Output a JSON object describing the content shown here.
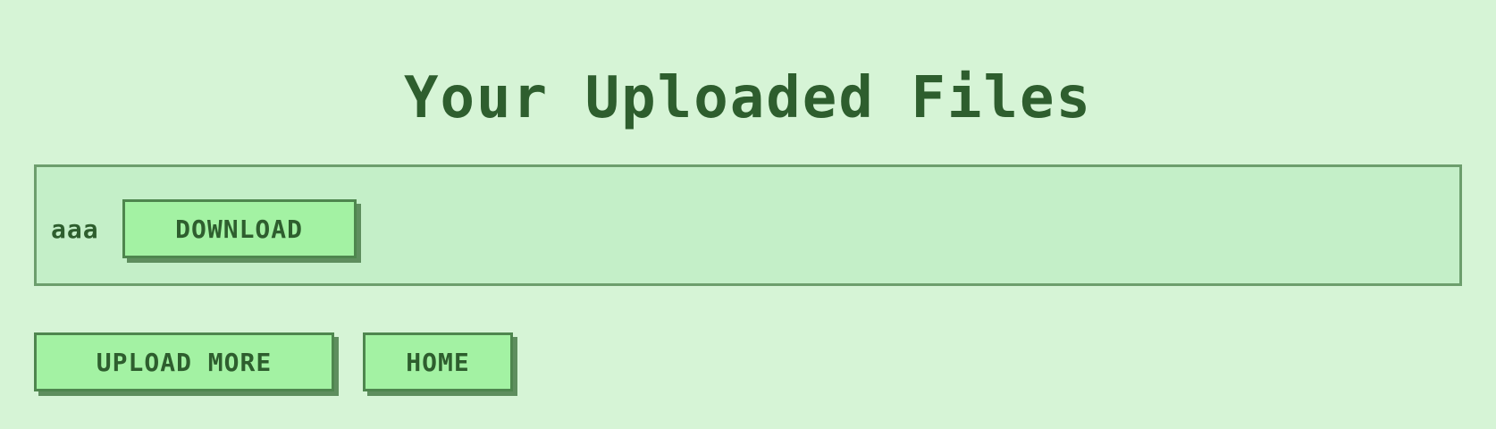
{
  "page": {
    "title": "Your Uploaded Files"
  },
  "files": [
    {
      "name": "aaa",
      "download_label": "DOWNLOAD"
    }
  ],
  "actions": {
    "upload_more_label": "UPLOAD MORE",
    "home_label": "HOME"
  },
  "colors": {
    "background": "#d6f4d6",
    "panel": "#c4efc8",
    "button": "#a3f2a3",
    "text": "#2e5e2e"
  }
}
